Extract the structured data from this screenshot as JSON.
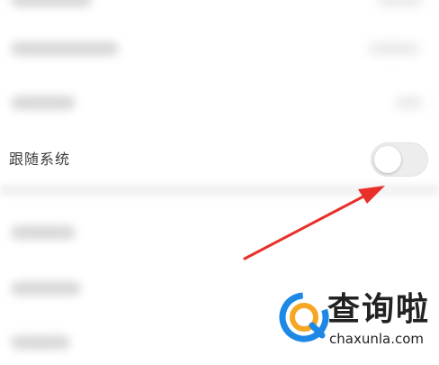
{
  "settings": {
    "follow_system_label": "跟随系统",
    "follow_system_toggle": "off"
  },
  "watermark": {
    "title": "查询啦",
    "domain": "chaxunla.com"
  },
  "colors": {
    "annotation_arrow": "#e8302a",
    "toggle_off": "#ededed",
    "logo_orange": "#f5a623",
    "logo_blue": "#1e88e5"
  }
}
